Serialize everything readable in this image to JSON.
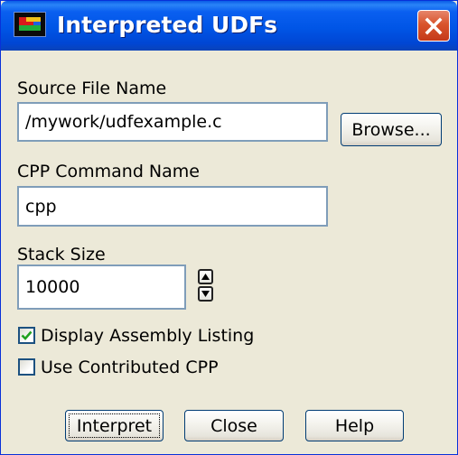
{
  "window": {
    "title": "Interpreted UDFs",
    "title_icon": "fluent-app-icon",
    "close_icon": "close-icon",
    "titlebar_color": "#0055e6",
    "close_color": "#d9542c",
    "face_color": "#ece9d8"
  },
  "source_file": {
    "label": "Source File Name",
    "value": "/mywork/udfexample.c",
    "browse_label": "Browse..."
  },
  "cpp_command": {
    "label": "CPP Command Name",
    "value": "cpp"
  },
  "stack_size": {
    "label": "Stack Size",
    "value": "10000",
    "up_icon": "spin-up-icon",
    "down_icon": "spin-down-icon"
  },
  "options": [
    {
      "label": "Display Assembly Listing",
      "checked": true
    },
    {
      "label": "Use Contributed CPP",
      "checked": false
    }
  ],
  "buttons": {
    "interpret": "Interpret",
    "close": "Close",
    "help": "Help"
  }
}
